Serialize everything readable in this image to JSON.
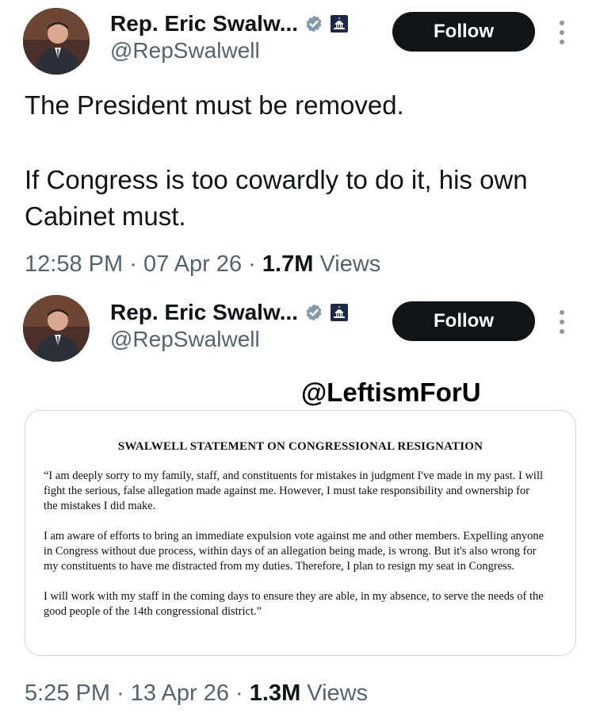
{
  "tweet1": {
    "name": "Rep. Eric Swalw...",
    "handle": "@RepSwalwell",
    "follow_label": "Follow",
    "text_line1": "The President must be removed.",
    "text_line2": "If Congress is too cowardly to do it, his own Cabinet must.",
    "time": "12:58 PM",
    "date": "07 Apr 26",
    "views_count": "1.7M",
    "views_label": "Views"
  },
  "tweet2": {
    "name": "Rep. Eric Swalw...",
    "handle": "@RepSwalwell",
    "follow_label": "Follow",
    "time": "5:25 PM",
    "date": "13 Apr 26",
    "views_count": "1.3M",
    "views_label": "Views"
  },
  "watermark": "@LeftismForU",
  "statement": {
    "title": "SWALWELL STATEMENT ON CONGRESSIONAL RESIGNATION",
    "para1": "“I am deeply sorry to my family, staff, and constituents for mistakes in judgment I've made in my past. I will fight the serious, false allegation made against me. However, I must take responsibility and ownership for the mistakes I did make.",
    "para2": "I am aware of efforts to bring an immediate expulsion vote against me and other members. Expelling anyone in Congress without due process, within days of an allegation being made, is wrong. But it's also wrong for my constituents to have me distracted from my duties. Therefore, I plan to resign my seat in Congress.",
    "para3": "I will work with my staff in the coming days to ensure they are able, in my absence, to serve the needs of the good people of the 14th congressional district.”"
  },
  "separator": "·",
  "icons": [
    "verified-badge-icon",
    "government-capitol-icon",
    "more-options-icon"
  ],
  "colors": {
    "follow_bg": "#0f1419",
    "secondary_text": "#536471",
    "verified_gray": "#829aab"
  }
}
